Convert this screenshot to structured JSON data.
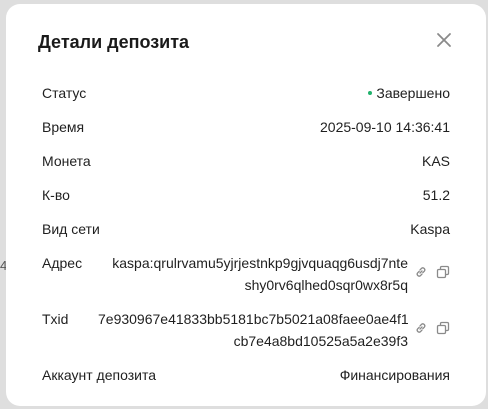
{
  "modal": {
    "title": "Детали депозита",
    "close_label": "close"
  },
  "details": {
    "status": {
      "label": "Статус",
      "value": "Завершено",
      "dot_color": "#20b26c"
    },
    "time": {
      "label": "Время",
      "value": "2025-09-10 14:36:41"
    },
    "coin": {
      "label": "Монета",
      "value": "KAS"
    },
    "quantity": {
      "label": "К-во",
      "value": "51.2"
    },
    "network": {
      "label": "Вид сети",
      "value": "Kaspa"
    },
    "address": {
      "label": "Адрес",
      "line1": "kaspa:qrulrvamu5yjrjestnkp9gjvquaqg6usdj7nte",
      "line2": "shy0rv6qlhed0sqr0wx8r5q"
    },
    "txid": {
      "label": "Txid",
      "line1": "7e930967e41833bb5181bc7b5021a08faee0ae4f1",
      "line2": "cb7e4a8bd10525a5a2e39f3"
    },
    "account": {
      "label": "Аккаунт депозита",
      "value": "Финансирования"
    }
  },
  "icons": {
    "close": "close-icon",
    "link": "link-icon",
    "copy": "copy-icon"
  },
  "colors": {
    "icon": "#8a8a8a",
    "text": "#1f1f1f"
  }
}
